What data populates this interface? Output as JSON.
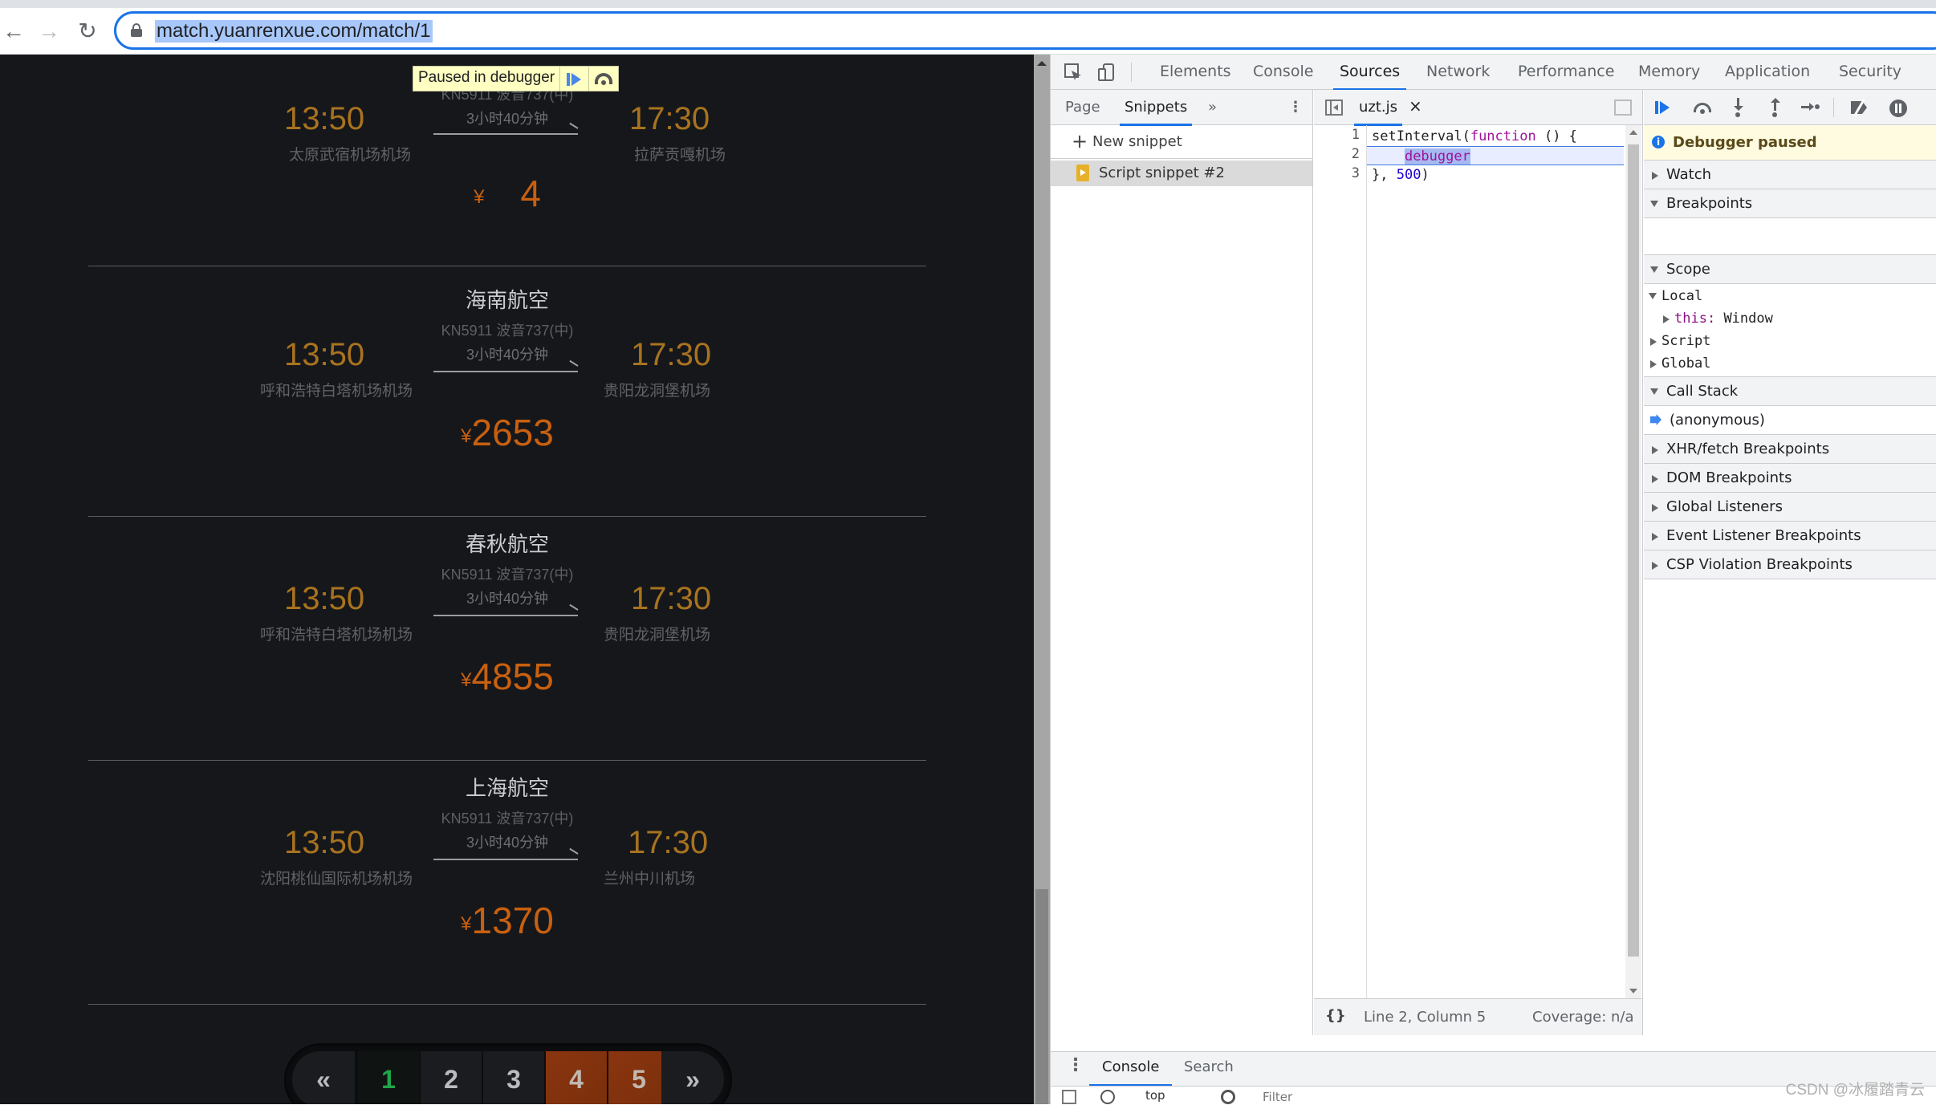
{
  "browser": {
    "url": "match.yuanrenxue.com/match/1",
    "back_icon": "arrow-left-icon",
    "forward_icon": "arrow-right-icon",
    "reload_icon": "reload-icon",
    "lock_icon": "lock-icon"
  },
  "overlay": {
    "label": "Paused in debugger",
    "resume_icon": "resume-icon",
    "step_over_icon": "step-over-icon"
  },
  "flights": [
    {
      "airline": "",
      "flight_no": "KN5911 波音737(中)",
      "duration": "3小时40分钟",
      "dep_time": "13:50",
      "dep_airport": "太原武宿机场机场",
      "arr_time": "17:30",
      "arr_airport": "拉萨贡嘎机场",
      "currency": "¥",
      "price": "4"
    },
    {
      "airline": "海南航空",
      "flight_no": "KN5911 波音737(中)",
      "duration": "3小时40分钟",
      "dep_time": "13:50",
      "dep_airport": "呼和浩特白塔机场机场",
      "arr_time": "17:30",
      "arr_airport": "贵阳龙洞堡机场",
      "currency": "¥",
      "price": "2653"
    },
    {
      "airline": "春秋航空",
      "flight_no": "KN5911 波音737(中)",
      "duration": "3小时40分钟",
      "dep_time": "13:50",
      "dep_airport": "呼和浩特白塔机场机场",
      "arr_time": "17:30",
      "arr_airport": "贵阳龙洞堡机场",
      "currency": "¥",
      "price": "4855"
    },
    {
      "airline": "上海航空",
      "flight_no": "KN5911 波音737(中)",
      "duration": "3小时40分钟",
      "dep_time": "13:50",
      "dep_airport": "沈阳桃仙国际机场机场",
      "arr_time": "17:30",
      "arr_airport": "兰州中川机场",
      "currency": "¥",
      "price": "1370"
    }
  ],
  "pagination": {
    "prev": "«",
    "next": "»",
    "pages": [
      "1",
      "2",
      "3",
      "4",
      "5"
    ],
    "current": "1",
    "colors": {
      "current": "#1fa64a",
      "highlight": "#8a3510"
    }
  },
  "devtools": {
    "tabs": [
      "Elements",
      "Console",
      "Sources",
      "Network",
      "Performance",
      "Memory",
      "Application",
      "Security"
    ],
    "active_tab": "Sources",
    "navigator": {
      "tabs": [
        "Page",
        "Snippets"
      ],
      "active": "Snippets",
      "more": "»",
      "new_snippet": "New snippet",
      "snippets": [
        "Script snippet #2"
      ]
    },
    "editor": {
      "file": "uzt.js",
      "close": "×",
      "lines": [
        "1",
        "2",
        "3"
      ],
      "code": {
        "l1_a": "setInterval(",
        "l1_kw": "function",
        "l1_b": " () {",
        "l2_indent": "    ",
        "l2_kw": "debugger",
        "l3_a": "}, ",
        "l3_num": "500",
        "l3_b": ")"
      },
      "status": {
        "format_icon": "{}",
        "position": "Line 2, Column 5",
        "coverage": "Coverage: n/a"
      }
    },
    "debugger": {
      "banner": "Debugger paused",
      "sections": {
        "watch": "Watch",
        "breakpoints": "Breakpoints",
        "scope": "Scope",
        "call_stack": "Call Stack",
        "xhr": "XHR/fetch Breakpoints",
        "dom": "DOM Breakpoints",
        "global": "Global Listeners",
        "event": "Event Listener Breakpoints",
        "csp": "CSP Violation Breakpoints"
      },
      "scope": {
        "local": "Local",
        "this_key": "this",
        "this_val": "Window",
        "script": "Script",
        "global": "Global"
      },
      "call_frames": [
        "(anonymous)"
      ]
    },
    "drawer": {
      "tabs": [
        "Console",
        "Search"
      ],
      "active": "Console",
      "context": "top",
      "filter_placeholder": "Filter"
    }
  },
  "watermark": "CSDN @冰履踏青云"
}
